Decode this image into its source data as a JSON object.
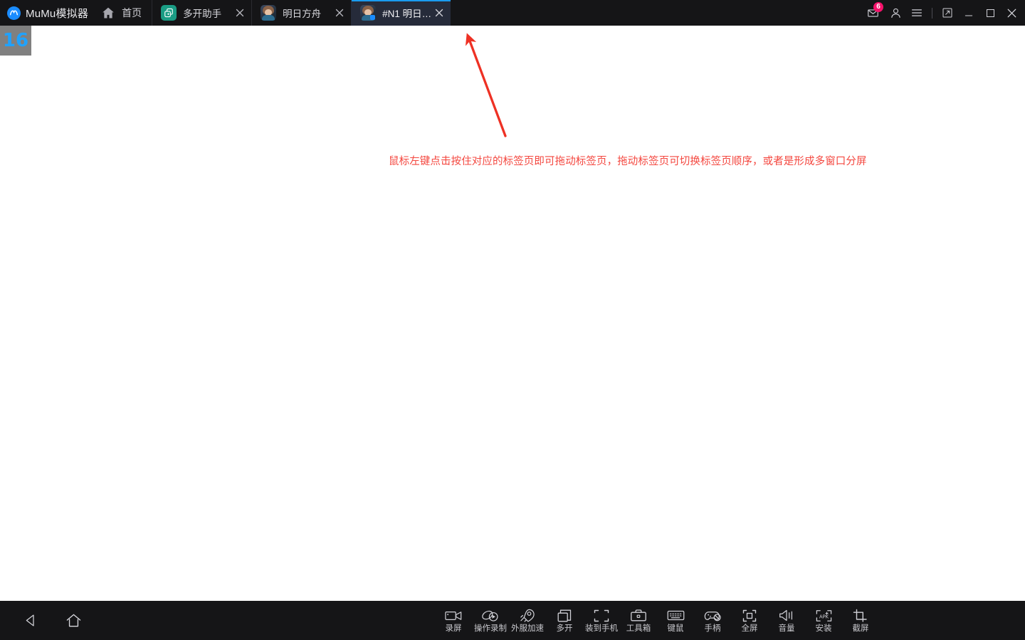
{
  "window": {
    "brand_logo_icon": "mumu-logo-icon",
    "brand_name": "MuMu模拟器",
    "home_icon": "home-icon",
    "home_label": "首页",
    "accent_color": "#1a9bf0",
    "titlebar_bg": "#151517",
    "active_tab_bg": "#262b3a"
  },
  "tabs": [
    {
      "icon": "multi-instance-icon",
      "title": "多开助手",
      "active": false,
      "close_icon": "close-icon"
    },
    {
      "icon": "game-avatar-icon",
      "title": "明日方舟",
      "active": false,
      "close_icon": "close-icon"
    },
    {
      "icon": "game-avatar-icon",
      "title": "#N1 明日方...",
      "active": true,
      "close_icon": "close-icon"
    }
  ],
  "window_controls": {
    "mail": {
      "icon": "mail-icon",
      "badge": "6",
      "badge_color": "#f5126b"
    },
    "account": {
      "icon": "user-icon"
    },
    "menu": {
      "icon": "hamburger-menu-icon"
    },
    "resize": {
      "icon": "resize-window-icon"
    },
    "minimize": {
      "icon": "minimize-icon"
    },
    "maximize": {
      "icon": "maximize-icon"
    },
    "close": {
      "icon": "close-icon"
    }
  },
  "content": {
    "corner_badge": "16",
    "corner_badge_color": "#1fa2ff",
    "annotation": {
      "text": "鼠标左键点击按住对应的标签页即可拖动标签页，拖动标签页可切换标签页顺序，或者是形成多窗口分屏",
      "color": "#f4473f",
      "arrow_icon": "red-arrow-icon"
    }
  },
  "bottom_bar": {
    "nav": [
      {
        "icon": "back-icon",
        "name": "back-button"
      },
      {
        "icon": "home-outline-icon",
        "name": "home-button"
      }
    ],
    "tools": [
      {
        "icon": "video-camera-icon",
        "label": "录屏"
      },
      {
        "icon": "macro-record-icon",
        "label": "操作录制"
      },
      {
        "icon": "rocket-accel-icon",
        "label": "外服加速"
      },
      {
        "icon": "multi-window-icon",
        "label": "多开"
      },
      {
        "icon": "install-to-phone-icon",
        "label": "装到手机"
      },
      {
        "icon": "toolbox-icon",
        "label": "工具箱"
      },
      {
        "icon": "keyboard-icon",
        "label": "键鼠"
      },
      {
        "icon": "gamepad-icon",
        "label": "手柄"
      },
      {
        "icon": "fullscreen-icon",
        "label": "全屏"
      },
      {
        "icon": "volume-icon",
        "label": "音量"
      },
      {
        "icon": "apk-install-icon",
        "label": "安装"
      },
      {
        "icon": "crop-screenshot-icon",
        "label": "截屏"
      }
    ]
  }
}
